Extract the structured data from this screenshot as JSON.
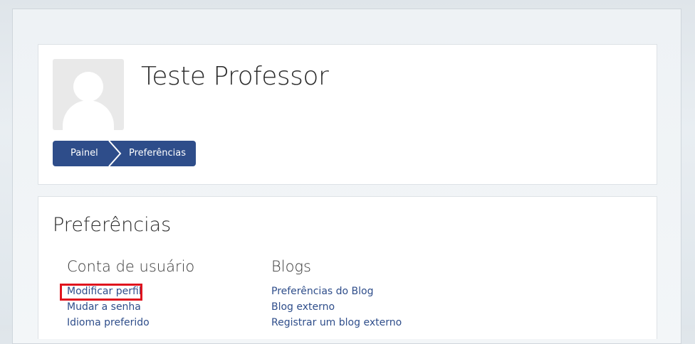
{
  "header": {
    "user_name": "Teste Professor"
  },
  "breadcrumb": {
    "items": [
      {
        "label": "Painel"
      },
      {
        "label": "Preferências"
      }
    ]
  },
  "preferences": {
    "title": "Preferências",
    "columns": [
      {
        "title": "Conta de usuário",
        "links": [
          "Modificar perfil",
          "Mudar a senha",
          "Idioma preferido"
        ]
      },
      {
        "title": "Blogs",
        "links": [
          "Preferências do Blog",
          "Blog externo",
          "Registrar um blog externo"
        ]
      }
    ],
    "highlighted_link": "Modificar perfil"
  },
  "colors": {
    "accent": "#2e4d8a",
    "highlight": "#e0141e"
  }
}
